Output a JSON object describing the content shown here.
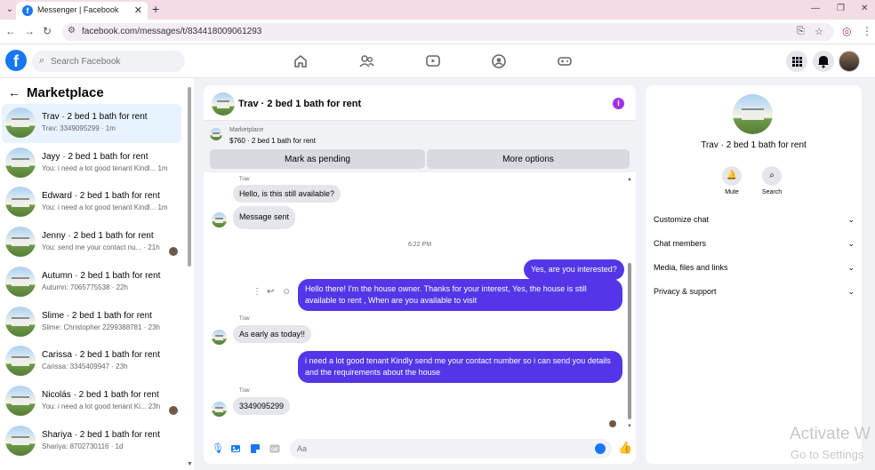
{
  "browser": {
    "tab_title": "Messenger | Facebook",
    "url": "facebook.com/messages/t/834418009061293"
  },
  "header": {
    "search_placeholder": "Search Facebook"
  },
  "marketplace": {
    "back_label": "←",
    "title": "Marketplace",
    "conversations": [
      {
        "name": "Trav · 2 bed 1 bath for rent",
        "preview": "Trav: 3349095299 · 1m",
        "active": true
      },
      {
        "name": "Jayy · 2 bed 1 bath for rent",
        "preview": "You: i need a lot good tenant Kindl...  1m"
      },
      {
        "name": "Edward · 2 bed 1 bath for rent",
        "preview": "You: i need a lot good tenant Kindl...  1m"
      },
      {
        "name": "Jenny · 2 bed 1 bath for rent",
        "preview": "You: send me your contact nu...  · 21h"
      },
      {
        "name": "Autumn · 2 bed 1 bath for rent",
        "preview": "Autumn: 7065775538 · 22h"
      },
      {
        "name": "Slime · 2 bed 1 bath for rent",
        "preview": "Slime: Christopher 2299388781 · 23h"
      },
      {
        "name": "Carissa · 2 bed 1 bath for rent",
        "preview": "Carissa: 3345409947 · 23h"
      },
      {
        "name": "Nicolás · 2 bed 1 bath for rent",
        "preview": "You: i need a lot good tenant Ki...  23h"
      },
      {
        "name": "Shariya · 2 bed 1 bath for rent",
        "preview": "Shariya: 8702730116 · 1d"
      }
    ]
  },
  "chat": {
    "title": "Trav · 2 bed 1 bath for rent",
    "info_label": "i",
    "listing_label": "Marketplace",
    "listing_price": "$760 · 2 bed 1 bath for rent",
    "mark_pending_label": "Mark as pending",
    "more_options_label": "More options",
    "messages": {
      "sender_1": "Trav",
      "m1": "Hello, is this still available?",
      "m2": "Message sent",
      "time_sep": "6:22 PM",
      "m3": "Yes, are you interested?",
      "m4": "Hello there! I'm the house owner. Thanks for your interest, Yes, the house is still available to rent , When are you available to visit",
      "sender_2": "Trav",
      "m5": "As early as today!!",
      "m6": "i need a lot good tenant Kindly send me your contact number so i can send you details and the requirements about the house",
      "sender_3": "Trav",
      "m7": "3349095299"
    },
    "composer_placeholder": "Aa"
  },
  "details": {
    "name": "Trav · 2 bed 1 bath for rent",
    "mute_label": "Mute",
    "search_label": "Search",
    "sections": [
      "Customize chat",
      "Chat members",
      "Media, files and links",
      "Privacy & support"
    ]
  },
  "watermark": {
    "line1": "Activate W",
    "line2": "Go to Settings"
  },
  "colors": {
    "accent": "#1877f2",
    "outgoing_bubble": "#5436e8",
    "info_icon": "#a033e8"
  }
}
